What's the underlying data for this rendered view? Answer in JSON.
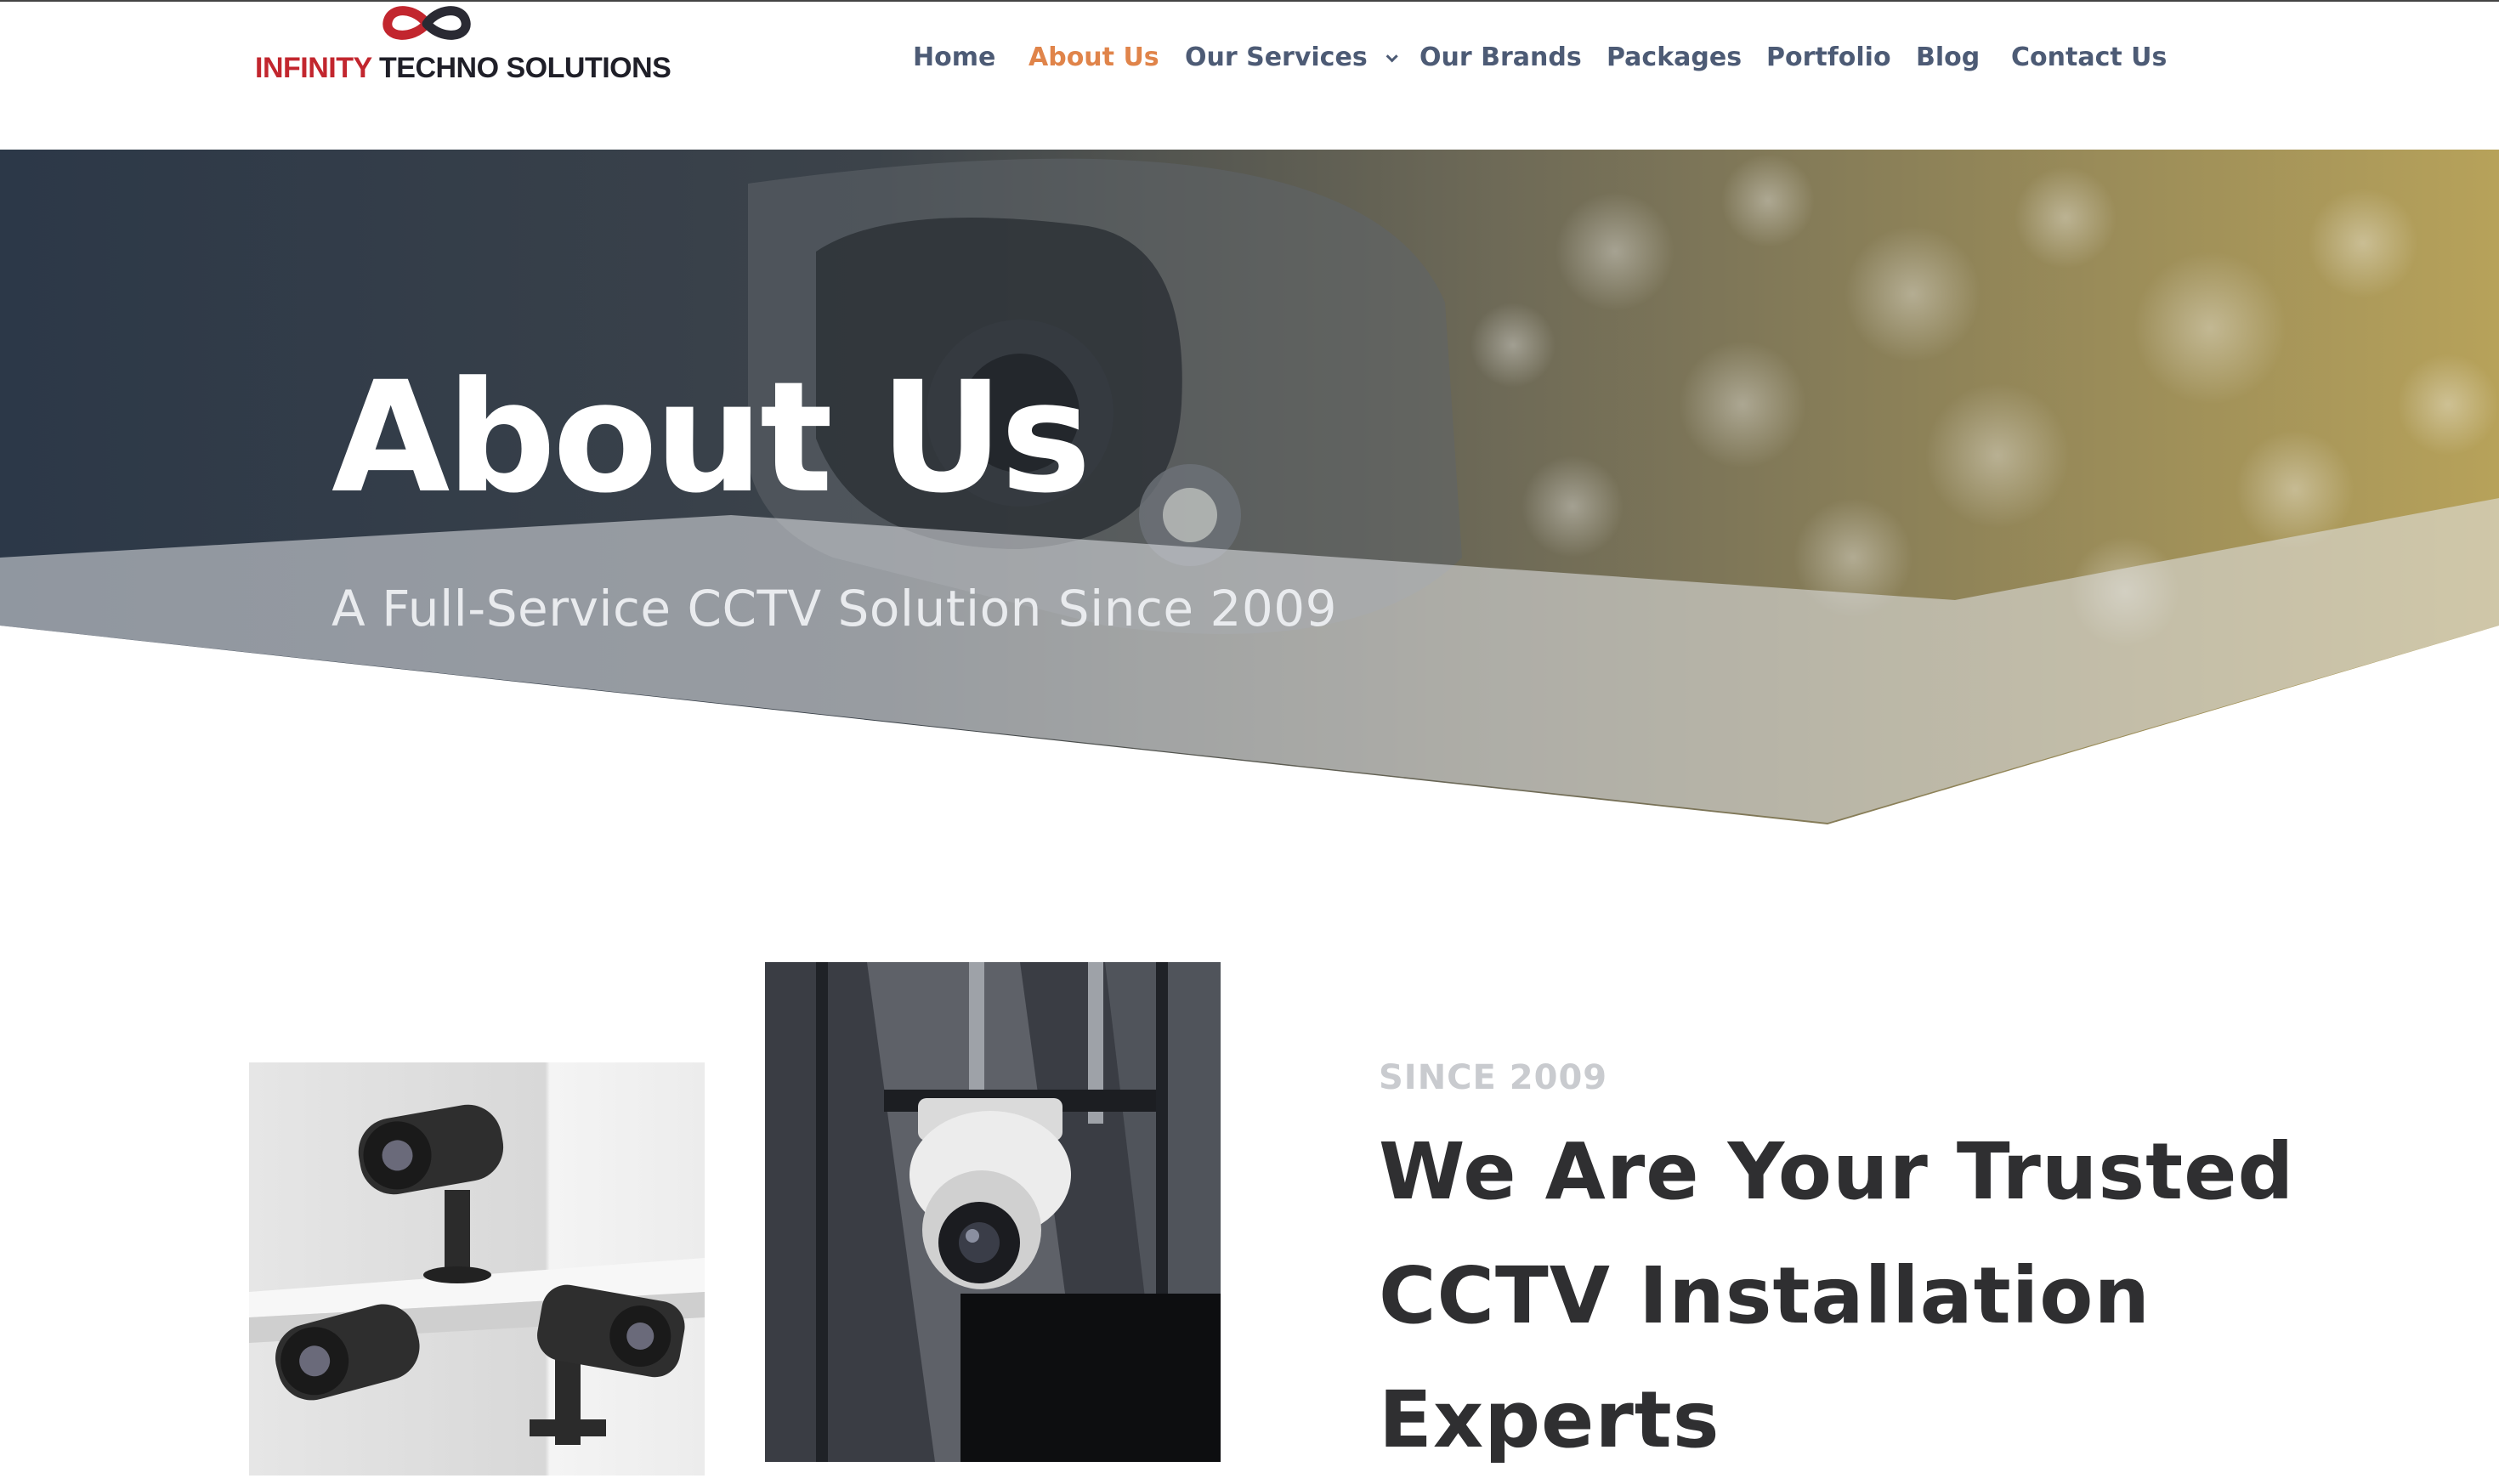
{
  "header": {
    "logo": {
      "word1": "INFINITY",
      "word2": "TECHNO SOLUTIONS"
    },
    "nav": [
      {
        "label": "Home"
      },
      {
        "label": "About Us"
      },
      {
        "label": "Our Services"
      },
      {
        "label": "Our Brands"
      },
      {
        "label": "Packages"
      },
      {
        "label": "Portfolio"
      },
      {
        "label": "Blog"
      },
      {
        "label": "Contact Us"
      }
    ],
    "active_nav": "About Us",
    "icons": {
      "logo": "infinity-logo-icon",
      "services_dropdown": "chevron-down-icon"
    }
  },
  "hero": {
    "title": "About Us",
    "subtitle": "A Full-Service CCTV Solution Since 2009"
  },
  "intro": {
    "eyebrow": "SINCE 2009",
    "headline": [
      "We Are Your Trusted",
      "CCTV Installation",
      "Experts"
    ]
  },
  "colors": {
    "nav_text": "#4d5b75",
    "nav_active": "#e0844a",
    "logo_red": "#c2262e",
    "logo_dark": "#1f1f28",
    "heading": "#2f2f31",
    "eyebrow": "#c9cbcf"
  }
}
